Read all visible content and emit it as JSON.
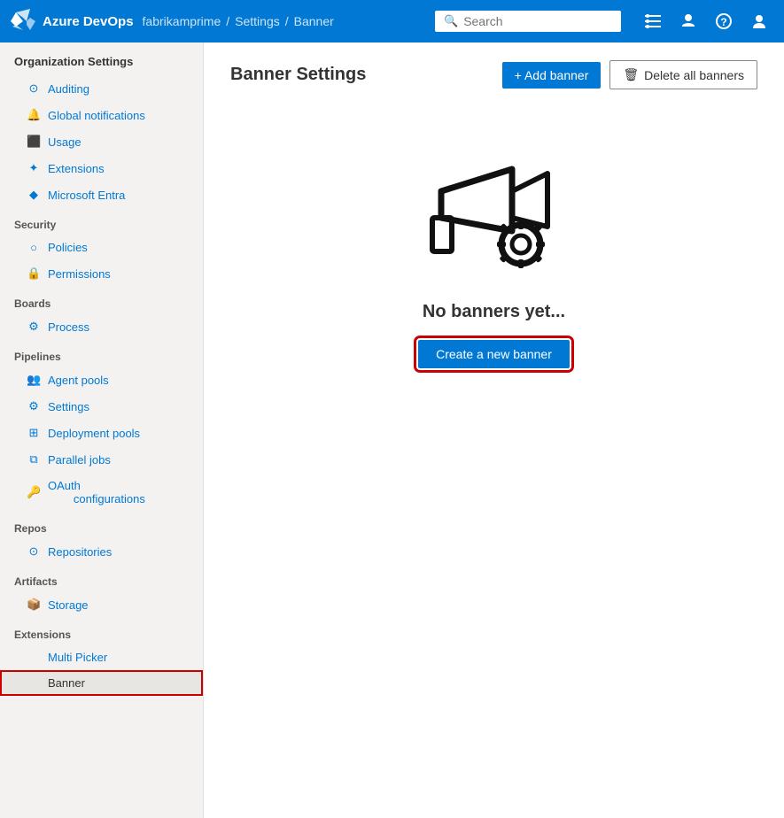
{
  "topnav": {
    "app_name": "Azure DevOps",
    "org": "fabrikamprime",
    "sep1": "/",
    "section": "Settings",
    "sep2": "/",
    "page": "Banner",
    "search_placeholder": "Search",
    "icons": {
      "list": "☰",
      "lock": "🔒",
      "help": "?",
      "user": "👤"
    }
  },
  "sidebar": {
    "header": "Organization Settings",
    "sections": [
      {
        "items": [
          {
            "id": "auditing",
            "label": "Auditing",
            "icon": "⊙"
          },
          {
            "id": "global-notifications",
            "label": "Global notifications",
            "icon": "🔔"
          },
          {
            "id": "usage",
            "label": "Usage",
            "icon": "📊"
          },
          {
            "id": "extensions",
            "label": "Extensions",
            "icon": "🧩"
          },
          {
            "id": "microsoft-entra",
            "label": "Microsoft Entra",
            "icon": "◆"
          }
        ]
      },
      {
        "title": "Security",
        "items": [
          {
            "id": "policies",
            "label": "Policies",
            "icon": "○"
          },
          {
            "id": "permissions",
            "label": "Permissions",
            "icon": "🔒"
          }
        ]
      },
      {
        "title": "Boards",
        "items": [
          {
            "id": "process",
            "label": "Process",
            "icon": "⚙"
          }
        ]
      },
      {
        "title": "Pipelines",
        "items": [
          {
            "id": "agent-pools",
            "label": "Agent pools",
            "icon": "👥"
          },
          {
            "id": "settings",
            "label": "Settings",
            "icon": "⚙"
          },
          {
            "id": "deployment-pools",
            "label": "Deployment pools",
            "icon": "⊞"
          },
          {
            "id": "parallel-jobs",
            "label": "Parallel jobs",
            "icon": "⧉"
          },
          {
            "id": "oauth-configurations",
            "label": "OAuth configurations",
            "icon": "🔑"
          }
        ]
      },
      {
        "title": "Repos",
        "items": [
          {
            "id": "repositories",
            "label": "Repositories",
            "icon": "⊙"
          }
        ]
      },
      {
        "title": "Artifacts",
        "items": [
          {
            "id": "storage",
            "label": "Storage",
            "icon": "📦"
          }
        ]
      },
      {
        "title": "Extensions",
        "items": [
          {
            "id": "multi-picker",
            "label": "Multi Picker",
            "icon": ""
          },
          {
            "id": "banner",
            "label": "Banner",
            "icon": "",
            "active": true
          }
        ]
      }
    ]
  },
  "content": {
    "title": "Banner Settings",
    "add_banner_label": "+ Add banner",
    "delete_banners_label": "Delete all banners",
    "empty_state": {
      "text": "No banners yet...",
      "create_label": "Create a new banner"
    }
  }
}
